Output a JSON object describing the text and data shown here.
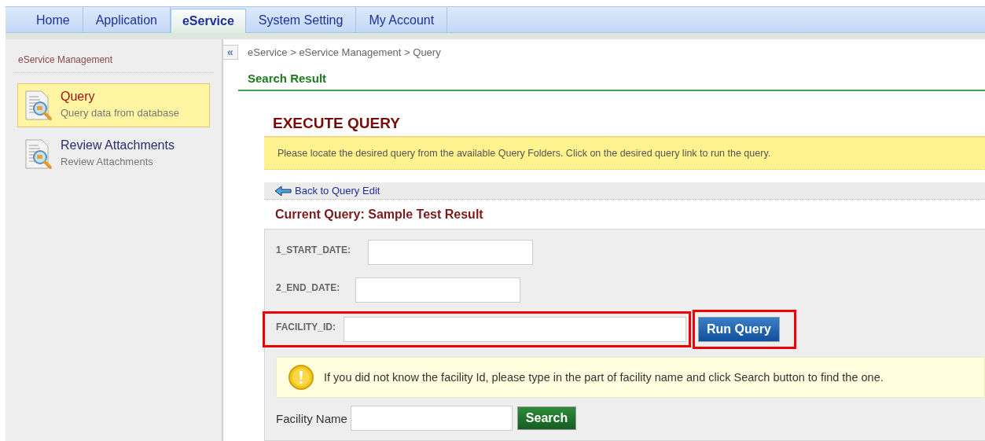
{
  "nav_tabs": [
    {
      "label": "Home",
      "selected": false
    },
    {
      "label": "Application",
      "selected": false
    },
    {
      "label": "eService",
      "selected": true
    },
    {
      "label": "System Setting",
      "selected": false
    },
    {
      "label": "My Account",
      "selected": false
    }
  ],
  "sidebar": {
    "title": "eService Management",
    "items": [
      {
        "title": "Query",
        "subtitle": "Query data from database",
        "selected": true
      },
      {
        "title": "Review Attachments",
        "subtitle": "Review Attachments",
        "selected": false
      }
    ]
  },
  "collapse_button": "«",
  "breadcrumb": "eService > eService Management > Query",
  "section_title": "Search Result",
  "heading": "EXECUTE QUERY",
  "instructions": "Please locate the desired query from the available Query Folders. Click on the desired query link to run the query.",
  "back_link": "Back to Query Edit",
  "current_query": "Current Query: Sample Test Result",
  "fields": [
    {
      "label": "1_START_DATE:"
    },
    {
      "label": "2_END_DATE:"
    },
    {
      "label": "FACILITY_ID:",
      "highlighted": true
    }
  ],
  "run_button": {
    "label": "Run Query",
    "highlighted": true
  },
  "hint": "If you did not know the facility Id, please type in the part of facility name and click Search button to find the one.",
  "facility_search": {
    "label": "Facility Name",
    "button": "Search"
  }
}
